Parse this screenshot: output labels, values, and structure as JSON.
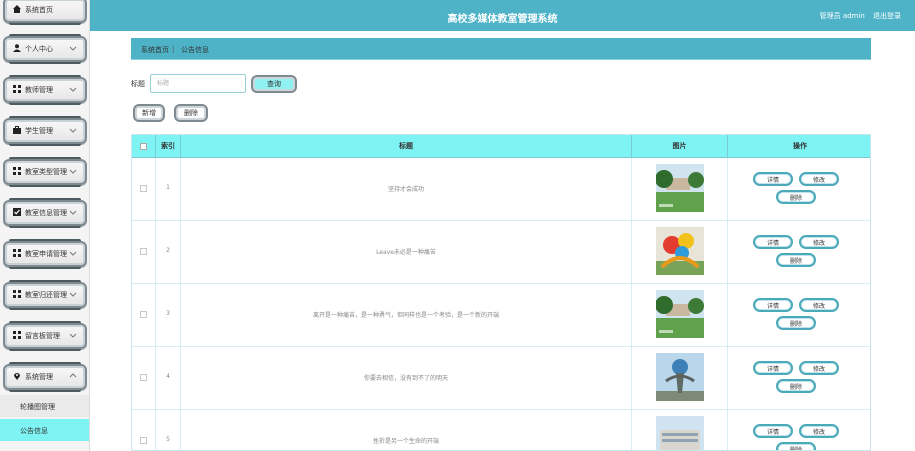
{
  "header": {
    "title": "高校多媒体教室管理系统",
    "user_label": "管理员 admin",
    "logout_label": "退出登录"
  },
  "sidebar": {
    "items": [
      {
        "label": "系统首页",
        "icon": "home-icon"
      },
      {
        "label": "个人中心",
        "icon": "user-icon"
      },
      {
        "label": "教师管理",
        "icon": "grid-icon"
      },
      {
        "label": "学生管理",
        "icon": "briefcase-icon"
      },
      {
        "label": "教室类型管理",
        "icon": "grid-icon"
      },
      {
        "label": "教室信息管理",
        "icon": "checklist-icon"
      },
      {
        "label": "教室申请管理",
        "icon": "grid-icon"
      },
      {
        "label": "教室归还管理",
        "icon": "grid-icon"
      },
      {
        "label": "留言板管理",
        "icon": "grid-icon"
      },
      {
        "label": "系统管理",
        "icon": "pin-icon"
      }
    ],
    "subitems": [
      {
        "label": "轮播图管理",
        "active": false
      },
      {
        "label": "公告信息",
        "active": true
      }
    ]
  },
  "breadcrumb": {
    "home": "系统首页",
    "separator": "|",
    "current": "公告信息"
  },
  "search": {
    "label": "标题",
    "placeholder": "标题",
    "button": "查询"
  },
  "actions": {
    "add": "新增",
    "delete": "删除"
  },
  "table": {
    "headers": {
      "index": "索引",
      "title": "标题",
      "image": "图片",
      "operation": "操作"
    },
    "rows": [
      {
        "index": "1",
        "title": "坚持才会成功",
        "image": "campus-lawn"
      },
      {
        "index": "2",
        "title": "Leave未必是一种痛苦",
        "image": "colorful-sculpture"
      },
      {
        "index": "3",
        "title": "离开是一种痛苦，是一种勇气，但同样也是一个考验，是一个新的开端",
        "image": "campus-lawn"
      },
      {
        "index": "4",
        "title": "你要去相信，没有到不了的明天",
        "image": "globe-sculpture"
      },
      {
        "index": "5",
        "title": "挫折是另一个生命的开端",
        "image": "building"
      }
    ],
    "op_detail": "详情",
    "op_edit": "修改",
    "op_delete": "删除"
  },
  "colors": {
    "accent": "#4fb3c8",
    "highlight": "#7ef3f3"
  }
}
